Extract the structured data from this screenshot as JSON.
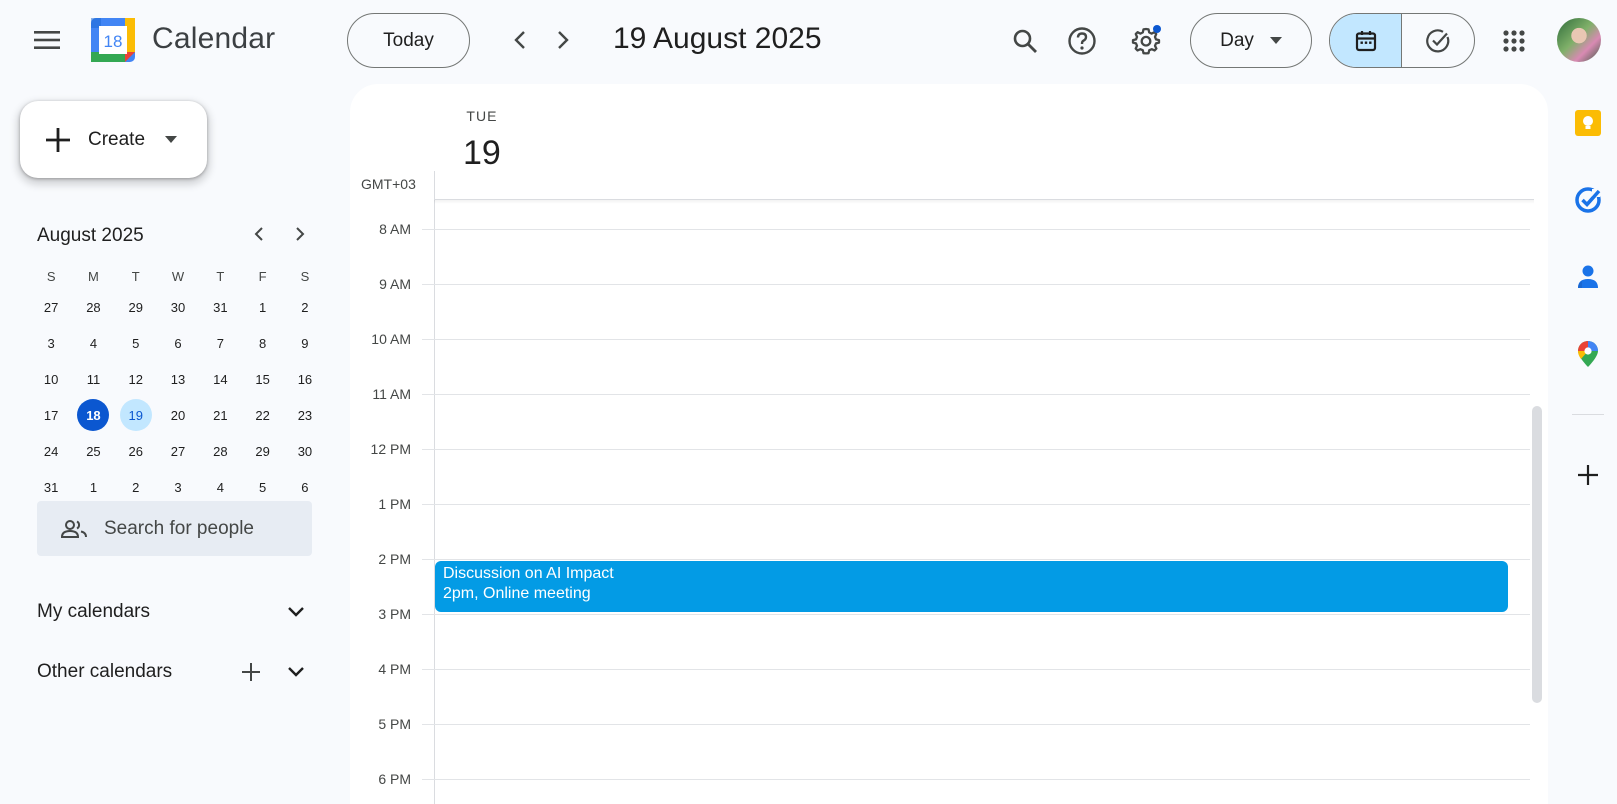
{
  "header": {
    "app_title": "Calendar",
    "logo_day": "18",
    "today_label": "Today",
    "date_title": "19 August 2025",
    "view_label": "Day"
  },
  "sidebar": {
    "create_label": "Create",
    "mini_calendar": {
      "month_label": "August 2025",
      "weekdays": [
        "S",
        "M",
        "T",
        "W",
        "T",
        "F",
        "S"
      ],
      "weeks": [
        [
          "27",
          "28",
          "29",
          "30",
          "31",
          "1",
          "2"
        ],
        [
          "3",
          "4",
          "5",
          "6",
          "7",
          "8",
          "9"
        ],
        [
          "10",
          "11",
          "12",
          "13",
          "14",
          "15",
          "16"
        ],
        [
          "17",
          "18",
          "19",
          "20",
          "21",
          "22",
          "23"
        ],
        [
          "24",
          "25",
          "26",
          "27",
          "28",
          "29",
          "30"
        ],
        [
          "31",
          "1",
          "2",
          "3",
          "4",
          "5",
          "6"
        ]
      ],
      "today": "18",
      "selected": "19"
    },
    "people_search_placeholder": "Search for people",
    "my_calendars_label": "My calendars",
    "other_calendars_label": "Other calendars"
  },
  "day_view": {
    "weekday": "TUE",
    "day_number": "19",
    "timezone": "GMT+03",
    "hours": [
      "8 AM",
      "9 AM",
      "10 AM",
      "11 AM",
      "12 PM",
      "1 PM",
      "2 PM",
      "3 PM",
      "4 PM",
      "5 PM",
      "6 PM"
    ],
    "events": [
      {
        "title": "Discussion on AI Impact",
        "subtitle": "2pm, Online meeting",
        "color": "#039be5"
      }
    ]
  },
  "side_panel": {
    "apps": [
      "keep-icon",
      "tasks-icon",
      "contacts-icon",
      "maps-icon",
      "add-icon"
    ]
  },
  "colors": {
    "accent": "#0b57d0",
    "selected_bg": "#c2e7ff",
    "event": "#039be5"
  }
}
